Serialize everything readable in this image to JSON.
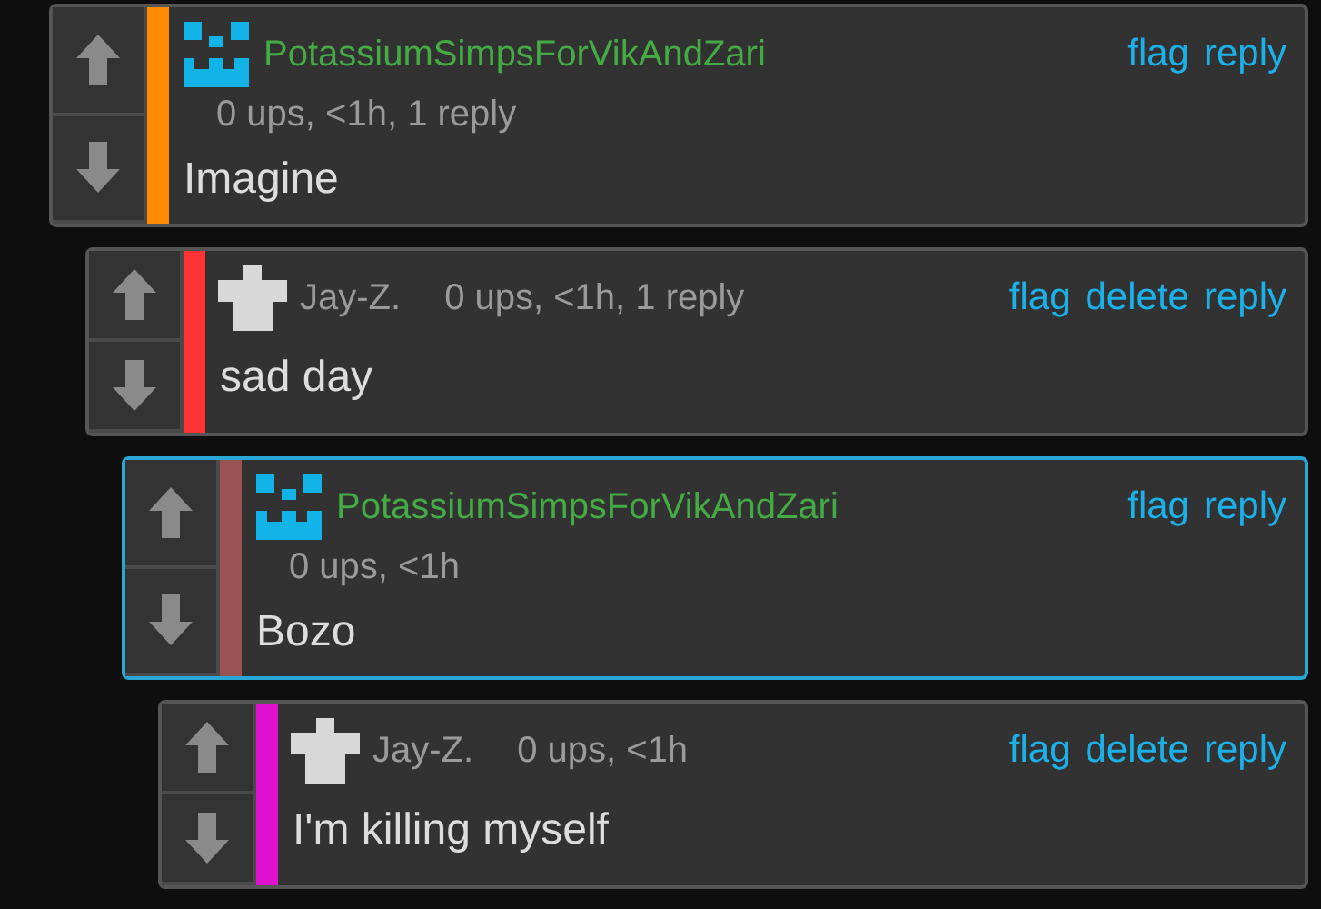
{
  "comments": [
    {
      "author": "PotassiumSimpsForVikAndZari",
      "avatar": {
        "kind": "blocks"
      },
      "kind": "stacked",
      "meta": "0 ups, <1h, 1 reply",
      "text": "Imagine",
      "color": "#ff8c00",
      "selected": false,
      "actions": [
        "flag",
        "reply"
      ]
    },
    {
      "author": "Jay-Z.",
      "avatar": {
        "kind": "shirt"
      },
      "kind": "inline",
      "meta": "0 ups, <1h, 1 reply",
      "text": "sad day",
      "color": "#ff3333",
      "selected": false,
      "actions": [
        "flag",
        "delete",
        "reply"
      ]
    },
    {
      "author": "PotassiumSimpsForVikAndZari",
      "avatar": {
        "kind": "blocks"
      },
      "kind": "stacked",
      "meta": "0 ups, <1h",
      "text": "Bozo",
      "color": "#9c5353",
      "selected": true,
      "actions": [
        "flag",
        "reply"
      ]
    },
    {
      "author": "Jay-Z.",
      "avatar": {
        "kind": "shirt"
      },
      "kind": "inline",
      "meta": "0 ups, <1h",
      "text": "I'm killing myself",
      "color": "#e010d0",
      "selected": false,
      "actions": [
        "flag",
        "delete",
        "reply"
      ]
    }
  ]
}
